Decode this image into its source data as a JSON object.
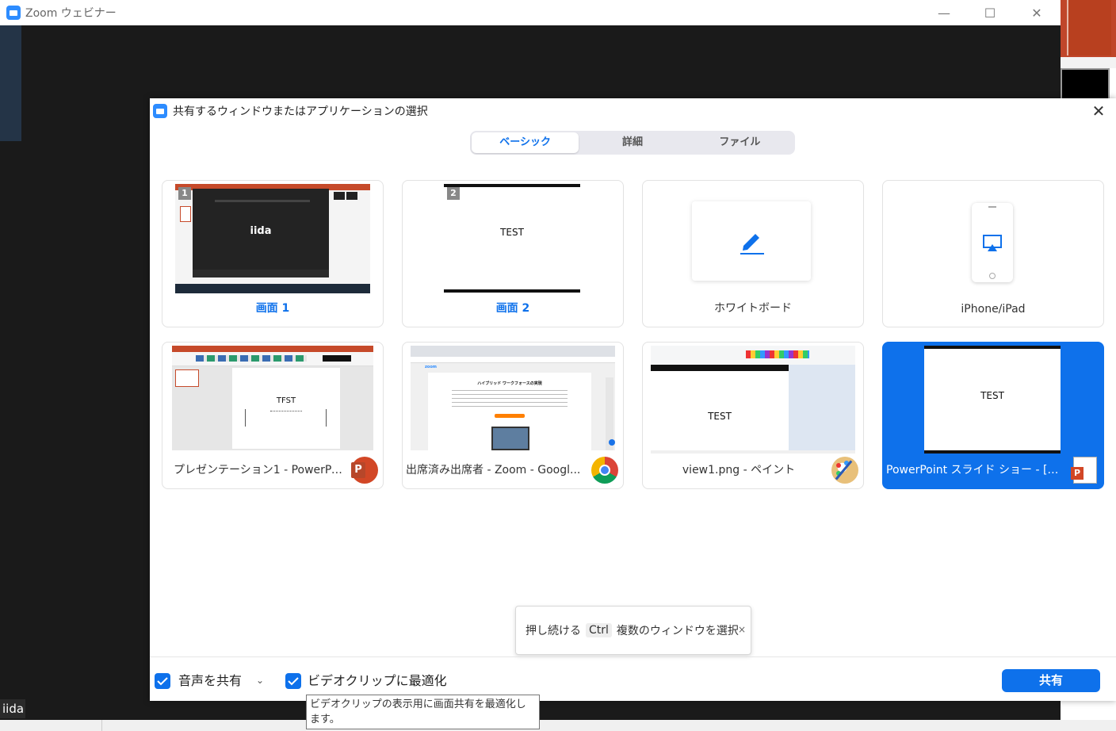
{
  "window": {
    "title": "Zoom ウェビナー",
    "minimize": "—",
    "maximize": "☐",
    "close": "✕"
  },
  "participant_name": "iida",
  "dialog": {
    "title": "共有するウィンドウまたはアプリケーションの選択",
    "close": "✕",
    "tabs": [
      {
        "label": "ベーシック",
        "active": true
      },
      {
        "label": "詳細",
        "active": false
      },
      {
        "label": "ファイル",
        "active": false
      }
    ],
    "tiles": [
      {
        "label": "画面 1",
        "badge": "1",
        "thumb_text": "iida"
      },
      {
        "label": "画面 2",
        "badge": "2",
        "thumb_text": "TEST"
      },
      {
        "label": "ホワイトボード"
      },
      {
        "label": "iPhone/iPad"
      },
      {
        "label": "プレゼンテーション1 - PowerPoint",
        "thumb_text": "TFST"
      },
      {
        "label": "出席済み出席者 - Zoom - Googl...",
        "thumb_heading": "ハイブリッド ワークフォースの実現",
        "thumb_logo": "zoom"
      },
      {
        "label": "view1.png - ペイント",
        "thumb_text": "TEST"
      },
      {
        "label": "PowerPoint スライド ショー - [プレゼ...",
        "thumb_text": "TEST",
        "selected": true
      }
    ],
    "hint": {
      "prefix": "押し続ける",
      "key": "Ctrl",
      "suffix": "複数のウィンドウを選択",
      "close": "×"
    },
    "footer": {
      "share_audio": "音声を共有",
      "optimize_video": "ビデオクリップに最適化",
      "share_button": "共有"
    },
    "video_tooltip": "ビデオクリップの表示用に画面共有を最適化します。"
  },
  "colors": {
    "accent": "#0e71eb",
    "zoom_blue": "#2d8cff",
    "ppt_red": "#d24726"
  }
}
